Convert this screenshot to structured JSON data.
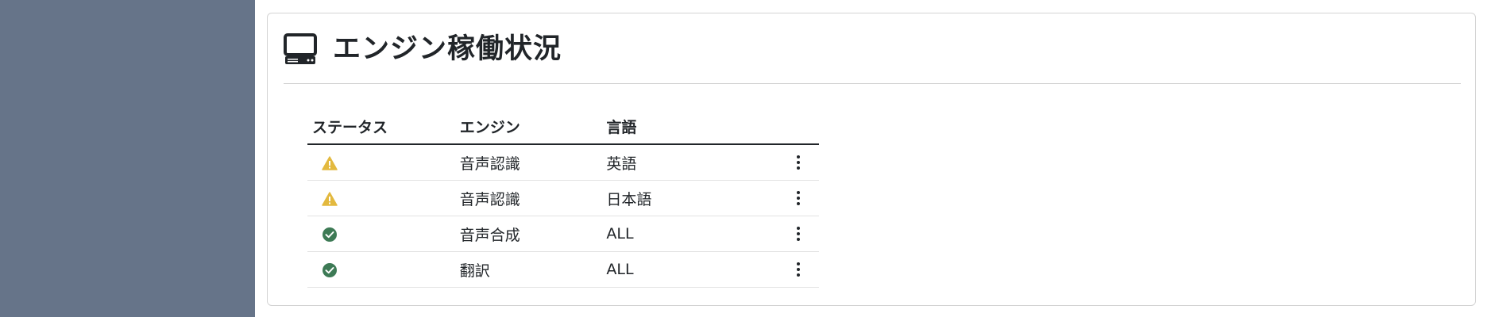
{
  "header": {
    "title": "エンジン稼働状況",
    "icon": "computer-icon"
  },
  "table": {
    "columns": [
      "ステータス",
      "エンジン",
      "言語",
      ""
    ],
    "rows": [
      {
        "status": "warning",
        "status_icon": "warning-icon",
        "status_color": "#e3b93f",
        "engine": "音声認識",
        "language": "英語"
      },
      {
        "status": "warning",
        "status_icon": "warning-icon",
        "status_color": "#e3b93f",
        "engine": "音声認識",
        "language": "日本語"
      },
      {
        "status": "ok",
        "status_icon": "check-circle-icon",
        "status_color": "#3d7a55",
        "engine": "音声合成",
        "language": "ALL"
      },
      {
        "status": "ok",
        "status_icon": "check-circle-icon",
        "status_color": "#3d7a55",
        "engine": "翻訳",
        "language": "ALL"
      }
    ]
  },
  "colors": {
    "sidebar": "#667489",
    "warning": "#e3b93f",
    "success": "#3d7a55",
    "text": "#212529"
  }
}
